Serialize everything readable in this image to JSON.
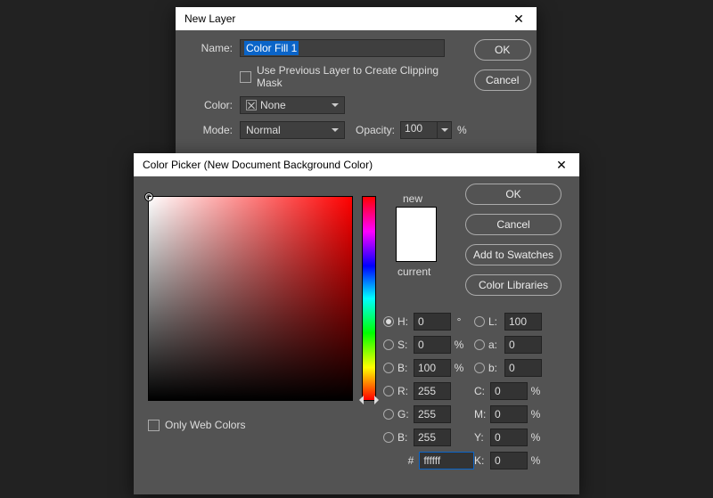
{
  "newLayer": {
    "title": "New Layer",
    "labels": {
      "name": "Name:",
      "color": "Color:",
      "mode": "Mode:",
      "opacity": "Opacity:"
    },
    "nameValue": "Color Fill 1",
    "clipMaskLabel": "Use Previous Layer to Create Clipping Mask",
    "clipMaskChecked": false,
    "colorValue": "None",
    "modeValue": "Normal",
    "opacityValue": "100",
    "opacityUnit": "%",
    "buttons": {
      "ok": "OK",
      "cancel": "Cancel"
    }
  },
  "colorPicker": {
    "title": "Color Picker (New Document Background Color)",
    "labels": {
      "new": "new",
      "current": "current",
      "onlyWeb": "Only Web Colors",
      "hash": "#"
    },
    "onlyWebChecked": false,
    "buttons": {
      "ok": "OK",
      "cancel": "Cancel",
      "addSwatches": "Add to Swatches",
      "colorLibraries": "Color Libraries"
    },
    "hsb": {
      "hLabel": "H:",
      "hValue": "0",
      "hUnit": "°",
      "sLabel": "S:",
      "sValue": "0",
      "sUnit": "%",
      "bLabel": "B:",
      "bValue": "100",
      "bUnit": "%",
      "selected": "H"
    },
    "lab": {
      "lLabel": "L:",
      "lValue": "100",
      "aLabel": "a:",
      "aValue": "0",
      "bLabel": "b:",
      "bValue": "0"
    },
    "rgb": {
      "rLabel": "R:",
      "rValue": "255",
      "gLabel": "G:",
      "gValue": "255",
      "bLabel": "B:",
      "bValue": "255"
    },
    "cmyk": {
      "cLabel": "C:",
      "cValue": "0",
      "mLabel": "M:",
      "mValue": "0",
      "yLabel": "Y:",
      "yValue": "0",
      "kLabel": "K:",
      "kValue": "0",
      "unit": "%"
    },
    "hexValue": "ffffff",
    "previewNew": "#ffffff",
    "previewCurrent": "#ffffff"
  }
}
